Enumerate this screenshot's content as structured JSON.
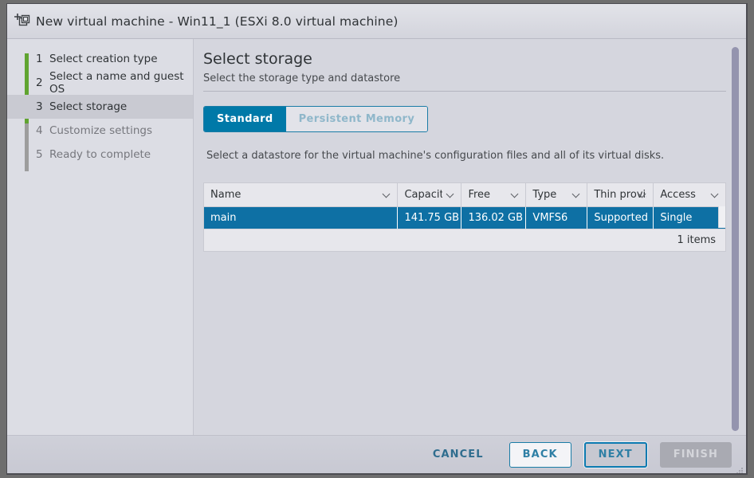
{
  "window": {
    "title": "New virtual machine - Win11_1 (ESXi 8.0 virtual machine)",
    "icon": "new-virtual-machine-icon"
  },
  "sidebar": {
    "steps": [
      {
        "num": "1",
        "label": "Select creation type",
        "state": "complete"
      },
      {
        "num": "2",
        "label": "Select a name and guest OS",
        "state": "complete"
      },
      {
        "num": "3",
        "label": "Select storage",
        "state": "active"
      },
      {
        "num": "4",
        "label": "Customize settings",
        "state": "pending"
      },
      {
        "num": "5",
        "label": "Ready to complete",
        "state": "pending"
      }
    ],
    "progress_color": "#60a430",
    "rail_color": "#9d9d9d"
  },
  "content": {
    "title": "Select storage",
    "subtitle": "Select the storage type and datastore",
    "storage_type_tabs": [
      {
        "label": "Standard",
        "state": "selected"
      },
      {
        "label": "Persistent Memory",
        "state": "disabled"
      }
    ],
    "helper_text": "Select a datastore for the virtual machine's configuration files and all of its virtual disks.",
    "accent_color": "#0079a8",
    "table": {
      "columns": [
        {
          "label": "Name",
          "sortable": true
        },
        {
          "label": "Capacity",
          "sortable": true
        },
        {
          "label": "Free",
          "sortable": true
        },
        {
          "label": "Type",
          "sortable": true
        },
        {
          "label": "Thin provisio",
          "sortable": true
        },
        {
          "label": "Access",
          "sortable": true
        }
      ],
      "rows": [
        {
          "name": "main",
          "capacity": "141.75 GB",
          "free": "136.02 GB",
          "type": "VMFS6",
          "thin_provisioning": "Supported",
          "access": "Single",
          "selected": true
        }
      ],
      "footer_count": "1 items",
      "selected_row_color": "#0e70a4"
    }
  },
  "footer": {
    "buttons": [
      {
        "label": "CANCEL",
        "style": "flat"
      },
      {
        "label": "BACK",
        "style": "outline"
      },
      {
        "label": "NEXT",
        "style": "focused"
      },
      {
        "label": "FINISH",
        "style": "disabled"
      }
    ]
  }
}
